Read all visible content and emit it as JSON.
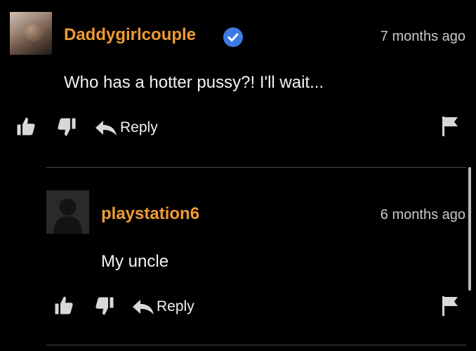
{
  "comments": [
    {
      "username": "Daddygirlcouple",
      "timestamp": "7 months ago",
      "text": "Who has a hotter pussy?! I'll wait...",
      "reply_label": "Reply",
      "verified": true
    },
    {
      "username": "playstation6",
      "timestamp": "6 months ago",
      "text": "My uncle",
      "reply_label": "Reply",
      "verified": false
    }
  ],
  "colors": {
    "background": "#000000",
    "username": "#ee9b32",
    "verified_badge": "#3d7be3",
    "text": "#f3f3f3",
    "timestamp": "#c9c9c9",
    "icon": "#d8d8d8",
    "divider": "#4a4a4a"
  },
  "icons": {
    "like": "thumbs-up-icon",
    "dislike": "thumbs-down-icon",
    "reply": "reply-arrow-icon",
    "flag": "flag-icon",
    "verified": "verified-check-icon"
  }
}
